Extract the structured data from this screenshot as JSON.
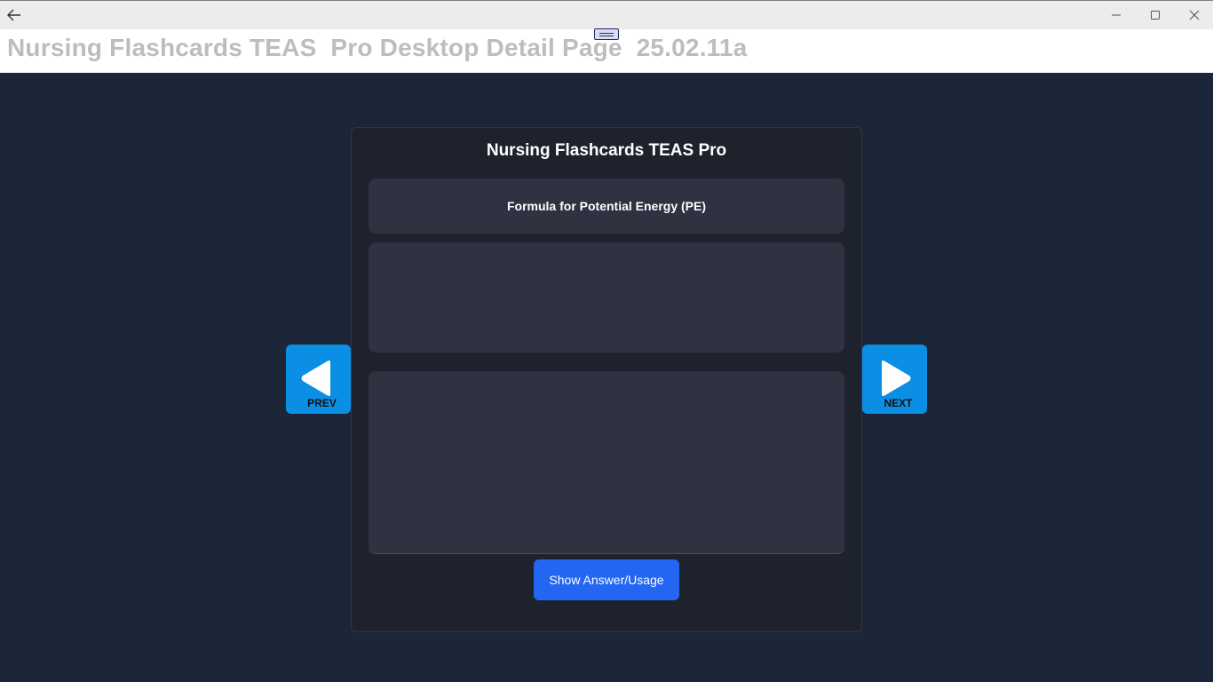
{
  "window": {
    "back_icon": "back-arrow-icon",
    "controls": [
      "minimize-icon",
      "maximize-icon",
      "close-icon"
    ]
  },
  "header": {
    "title": "Nursing Flashcards TEAS  Pro Desktop Detail Page  25.02.11a"
  },
  "panel": {
    "title": "Nursing Flashcards TEAS Pro",
    "question": "Formula for Potential Energy (PE)",
    "detail": "",
    "answer": "",
    "show_button_label": "Show Answer/Usage"
  },
  "nav": {
    "prev_label": "PREV",
    "next_label": "NEXT"
  },
  "colors": {
    "background": "#1b2638",
    "panel": "#1e222c",
    "card": "#2e3241",
    "accent_button": "#2266f2",
    "nav_button": "#0a8fe4"
  }
}
